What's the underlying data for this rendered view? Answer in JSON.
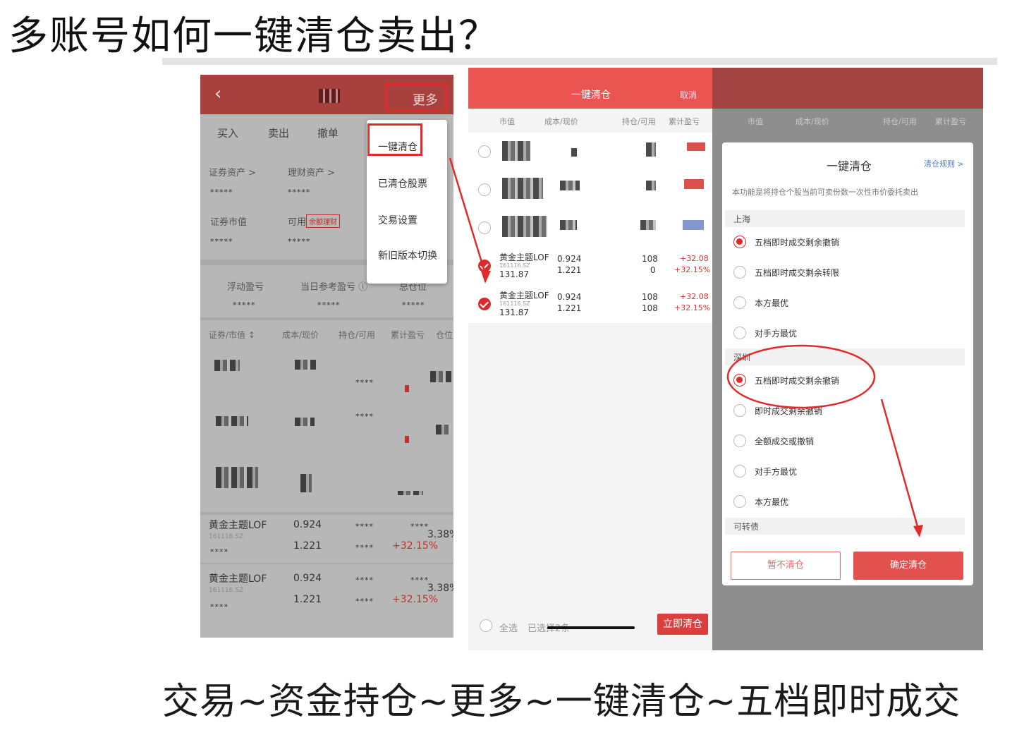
{
  "slide": {
    "title": "多账号如何一键清仓卖出？",
    "caption": "交易~资金持仓~更多~一键清仓~五档即时成交"
  },
  "panel1": {
    "back_icon": "chevron-left-icon",
    "more_label": "更多",
    "tabs": [
      "买入",
      "卖出",
      "撤单"
    ],
    "securities_assets_label": "证券资产 >",
    "financial_assets_label": "理财资产 >",
    "masked": "*****",
    "market_value_label": "证券市值",
    "available_label": "可用",
    "balance_badge": "余额理财",
    "floating_pl_label": "浮动盈亏",
    "today_pl_label": "当日参考盈亏 ⓘ",
    "total_label": "总仓位",
    "col_security": "证券/市值 ↕",
    "col_cost": "成本/现价",
    "col_position": "持仓/可用",
    "col_pl": "累计盈亏",
    "col_ratio": "仓位",
    "masked_short": "****",
    "holdings": [
      {
        "name": "黄金主题LOF",
        "code": "161116.SZ",
        "cost": "0.924",
        "price": "1.221",
        "ratio": "3.38%",
        "pl_pct": "+32.15%"
      },
      {
        "name": "黄金主题LOF",
        "code": "161116.SZ",
        "cost": "0.924",
        "price": "1.221",
        "ratio": "3.38%",
        "pl_pct": "+32.15%"
      }
    ],
    "menu": [
      "一键清仓",
      "已清仓股票",
      "交易设置",
      "新旧版本切换"
    ]
  },
  "panel2": {
    "title": "一键清仓",
    "cancel": "取消",
    "col_value": "市值",
    "col_cost": "成本/现价",
    "col_position": "持仓/可用",
    "col_pl": "累计盈亏",
    "holdings": [
      {
        "name": "黄金主题LOF",
        "code": "161116.SZ",
        "value": "131.87",
        "cost": "0.924",
        "price": "1.221",
        "position": "108",
        "available": "0",
        "pl": "+32.08",
        "pl_pct": "+32.15%"
      },
      {
        "name": "黄金主题LOF",
        "code": "161116.SZ",
        "value": "131.87",
        "cost": "0.924",
        "price": "1.221",
        "position": "108",
        "available": "108",
        "pl": "+32.08",
        "pl_pct": "+32.15%"
      }
    ],
    "select_all": "全选",
    "selected": "已选择2条",
    "clear_now": "立即清仓"
  },
  "panel3": {
    "col_value": "市值",
    "col_cost": "成本/现价",
    "col_position": "持仓/可用",
    "col_pl": "累计盈亏",
    "dialog_title": "一键清仓",
    "rules_link": "清仓规则 >",
    "description": "本功能是将持仓个股当前可卖份数一次性市价委托卖出",
    "section_sh": "上海",
    "sh_options": [
      "五档即时成交剩余撤销",
      "五档即时成交剩余转限",
      "本方最优",
      "对手方最优"
    ],
    "section_sz": "深圳",
    "sz_options": [
      "五档即时成交剩余撤销",
      "即时成交剩余撤销",
      "全额成交或撤销",
      "对手方最优",
      "本方最优"
    ],
    "section_cb": "可转债",
    "btn_cancel": "暂不清仓",
    "btn_confirm": "确定清仓"
  },
  "colors": {
    "accent": "#e12b2b",
    "header": "#ea5552",
    "profit": "#d5332f"
  }
}
